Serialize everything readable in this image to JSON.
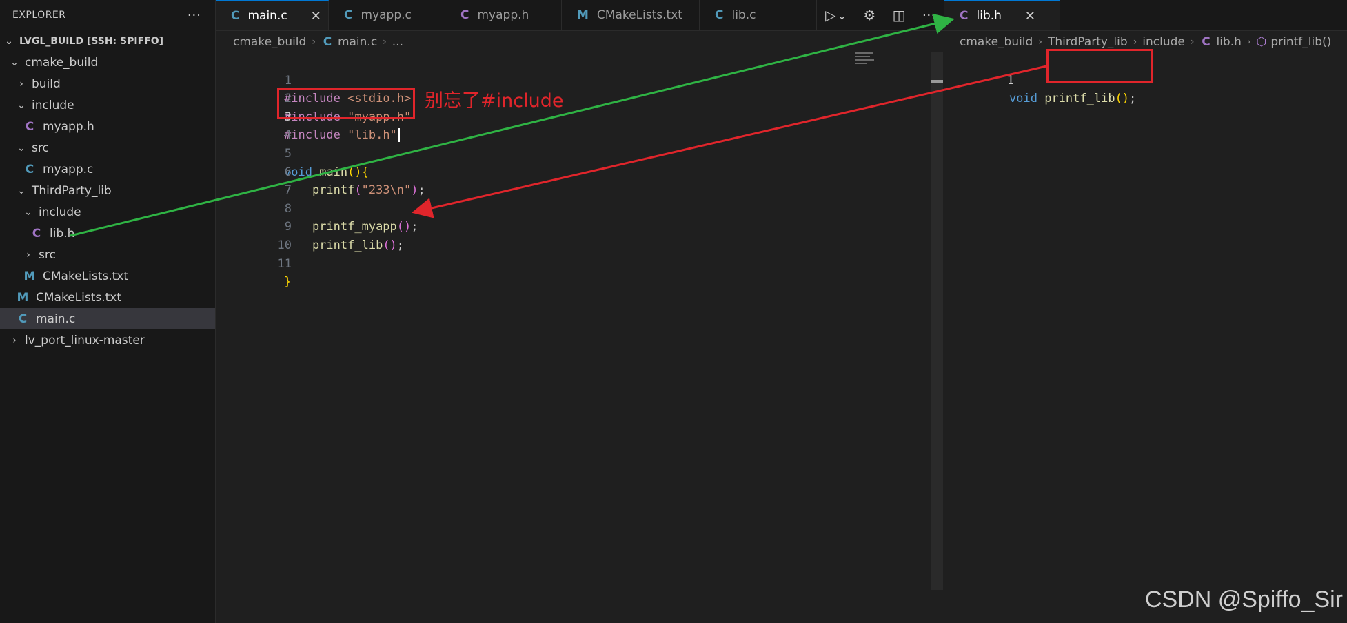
{
  "explorer": {
    "title": "EXPLORER",
    "more": "···",
    "root_label": "LVGL_BUILD [SSH: SPIFFO]",
    "items": [
      {
        "label": "cmake_build",
        "kind": "folder",
        "open": true
      },
      {
        "label": "build",
        "kind": "folder",
        "open": false
      },
      {
        "label": "include",
        "kind": "folder",
        "open": true
      },
      {
        "label": "myapp.h",
        "kind": "file",
        "icon": "C"
      },
      {
        "label": "src",
        "kind": "folder",
        "open": true
      },
      {
        "label": "myapp.c",
        "kind": "file",
        "icon": "C"
      },
      {
        "label": "ThirdParty_lib",
        "kind": "folder",
        "open": true
      },
      {
        "label": "include",
        "kind": "folder",
        "open": true
      },
      {
        "label": "lib.h",
        "kind": "file",
        "icon": "C"
      },
      {
        "label": "src",
        "kind": "folder",
        "open": false
      },
      {
        "label": "CMakeLists.txt",
        "kind": "file",
        "icon": "M"
      },
      {
        "label": "CMakeLists.txt",
        "kind": "file",
        "icon": "M"
      },
      {
        "label": "main.c",
        "kind": "file",
        "icon": "C",
        "selected": true
      },
      {
        "label": "lv_port_linux-master",
        "kind": "folder",
        "open": false
      }
    ]
  },
  "tabs_left": [
    {
      "label": "main.c",
      "icon": "C",
      "active": true,
      "close": "✕"
    },
    {
      "label": "myapp.c",
      "icon": "C"
    },
    {
      "label": "myapp.h",
      "icon": "C"
    },
    {
      "label": "CMakeLists.txt",
      "icon": "M"
    },
    {
      "label": "lib.c",
      "icon": "C"
    }
  ],
  "tabs_right": [
    {
      "label": "lib.h",
      "icon": "C",
      "active": true,
      "close": "✕"
    }
  ],
  "editor_actions": {
    "run_icon": "run-debug-icon",
    "dropdown_icon": "chevron-down-icon",
    "settings_icon": "gear-icon",
    "split_icon": "split-editor-icon",
    "more_icon": "more-icon",
    "run_glyph": "▷",
    "dropdown_glyph": "⌄",
    "settings_glyph": "⚙",
    "split_glyph": "◫",
    "more_glyph": "···"
  },
  "breadcrumb_left": {
    "parts": [
      "cmake_build",
      "main.c",
      "..."
    ],
    "file_icon": "C"
  },
  "breadcrumb_right": {
    "parts": [
      "cmake_build",
      "ThirdParty_lib",
      "include",
      "lib.h",
      "printf_lib()"
    ],
    "file_icon": "C",
    "symbol_icon": "cube-icon"
  },
  "left_code": {
    "line_numbers": [
      "1",
      "2",
      "3",
      "4",
      "5",
      "6",
      "7",
      "8",
      "9",
      "10",
      "11"
    ],
    "current_line": "3"
  },
  "right_code": {
    "line_numbers": [
      "1"
    ]
  },
  "annotation": {
    "note": "别忘了#include",
    "color": "#e0252b",
    "arrow_green": "#2fb344",
    "arrow_red": "#e0252b"
  },
  "watermark": "CSDN @Spiffo_Sir",
  "colors": {
    "editor_bg": "#1f1f1f",
    "sidebar_bg": "#181818",
    "selection_bg": "#37373d",
    "accent": "#0078d4",
    "c_icon": "#519aba",
    "h_icon": "#a074c4"
  }
}
